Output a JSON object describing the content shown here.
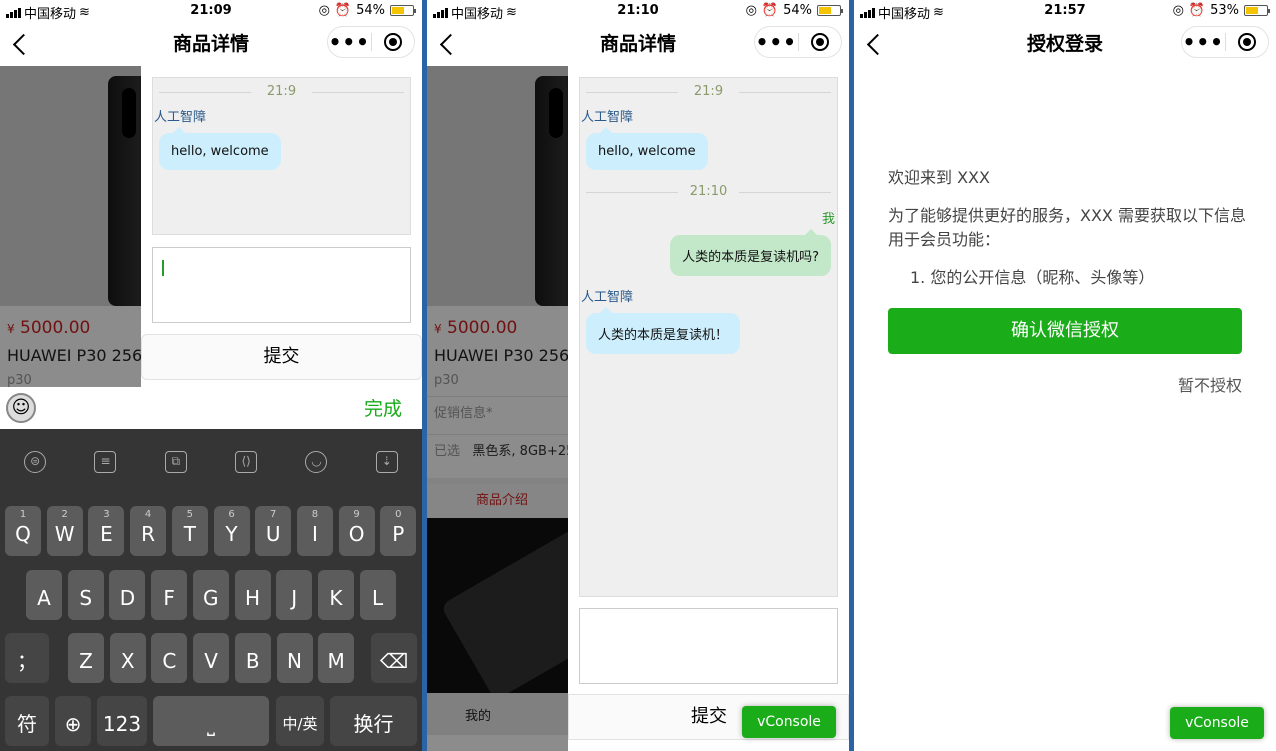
{
  "status": {
    "carrier": "中国移动",
    "p1": {
      "time": "21:09",
      "battery": "54%",
      "battery_level": 0.54
    },
    "p2": {
      "time": "21:10",
      "battery": "54%",
      "battery_level": 0.54
    },
    "p3": {
      "time": "21:57",
      "battery": "53%",
      "battery_level": 0.53
    }
  },
  "nav": {
    "product_title": "商品详情",
    "auth_title": "授权登录",
    "more_label": "•••"
  },
  "product": {
    "currency": "¥",
    "price": "5000.00",
    "name": "HUAWEI P30 256",
    "model": "p30",
    "promo": "促销信息*",
    "selected_label": "已选",
    "selected_value": "黑色系, 8GB+25",
    "intro_tab": "商品介绍",
    "tab_mine": "我的"
  },
  "chat": {
    "time1": "21:9",
    "time2": "21:10",
    "bot_name": "人工智障",
    "me_label": "我",
    "welcome": "hello, welcome",
    "user_msg": "人类的本质是复读机吗?",
    "bot_reply": "人类的本质是复读机！",
    "submit": "提交"
  },
  "keyboard": {
    "done": "完成",
    "row1": [
      [
        "1",
        "Q"
      ],
      [
        "2",
        "W"
      ],
      [
        "3",
        "E"
      ],
      [
        "4",
        "R"
      ],
      [
        "5",
        "T"
      ],
      [
        "6",
        "Y"
      ],
      [
        "7",
        "U"
      ],
      [
        "8",
        "I"
      ],
      [
        "9",
        "O"
      ],
      [
        "0",
        "P"
      ]
    ],
    "row2": [
      "A",
      "S",
      "D",
      "F",
      "G",
      "H",
      "J",
      "K",
      "L"
    ],
    "row3": [
      "Z",
      "X",
      "C",
      "V",
      "B",
      "N",
      "M"
    ],
    "symbol": "符",
    "num": "123",
    "lang": "中/英",
    "enter": "换行",
    "semicolon": "；"
  },
  "auth": {
    "welcome": "欢迎来到 XXX",
    "desc": "为了能够提供更好的服务，XXX 需要获取以下信息用于会员功能：",
    "item1": "1. 您的公开信息（昵称、头像等）",
    "confirm": "确认微信授权",
    "skip": "暂不授权"
  },
  "vconsole": "vConsole",
  "colors": {
    "wechat_green": "#1aad19",
    "price_red": "#d01f1f",
    "bot_bubble": "#cdeefc",
    "user_bubble": "#c3e7c9"
  }
}
